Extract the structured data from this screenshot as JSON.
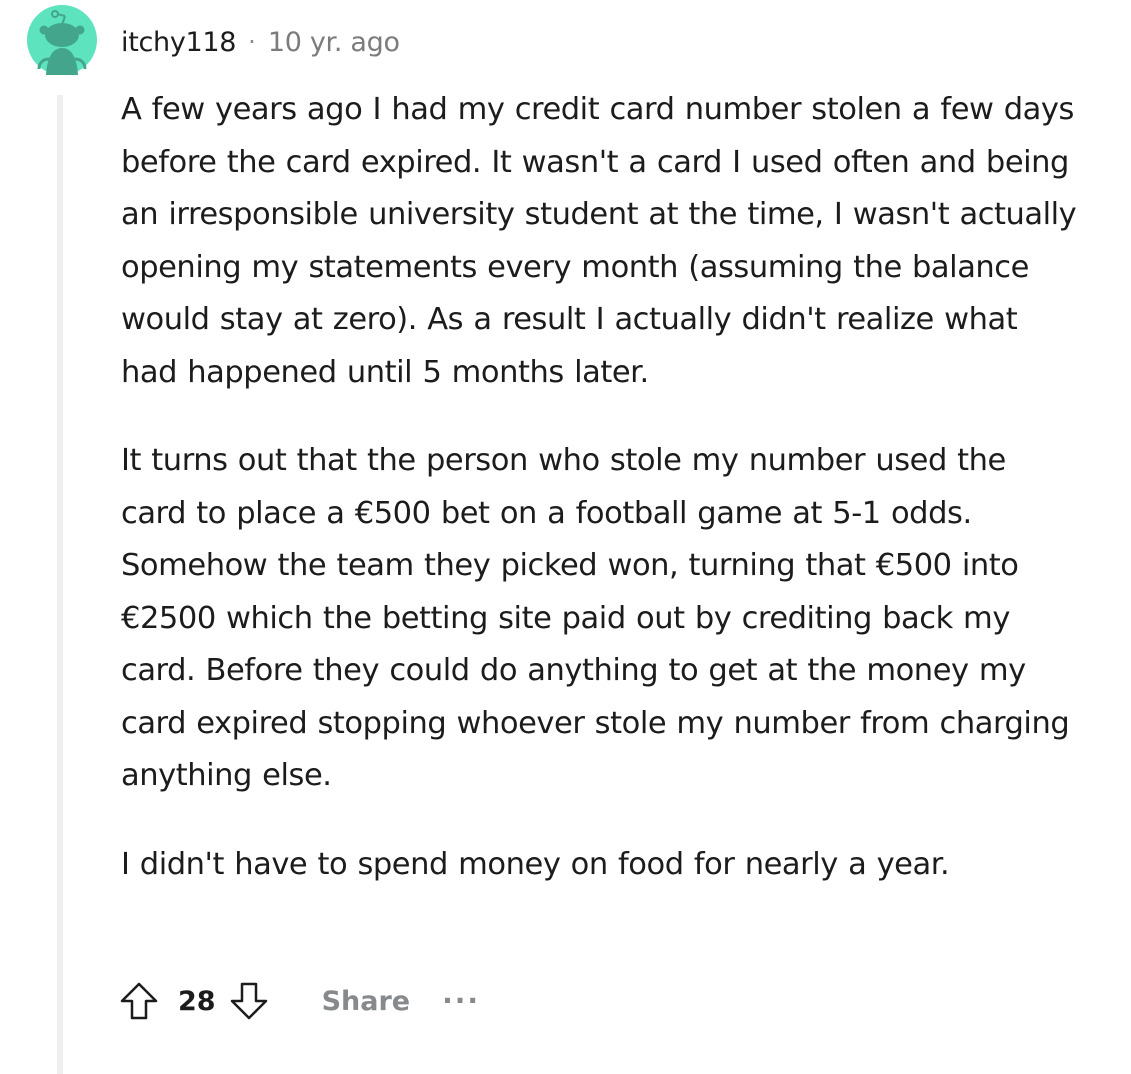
{
  "comment": {
    "author": "itchy118",
    "separator": "·",
    "timestamp": "10 yr. ago",
    "avatar_icon": "snoo-avatar-icon",
    "avatar_color": "#5de4be",
    "paragraphs": [
      "A few years ago I had my credit card number stolen a few days before the card expired. It wasn't a card I used often and being an irresponsible university student at the time, I wasn't actually opening my statements every month (assuming the balance would stay at zero). As a result I actually didn't realize what had happened until 5 months later.",
      "It turns out that the person who stole my number used the card to place a €500 bet on a football game at 5-1 odds. Somehow the team they picked won, turning that €500 into €2500 which the betting site paid out by crediting back my card. Before they could do anything to get at the money my card expired stopping whoever stole my number from charging anything else.",
      "I didn't have to spend money on food for nearly a year."
    ],
    "actions": {
      "upvote_icon": "upvote-arrow-icon",
      "score": "28",
      "downvote_icon": "downvote-arrow-icon",
      "share_label": "Share",
      "more_label": "...",
      "more_icon": "more-options-icon"
    }
  }
}
